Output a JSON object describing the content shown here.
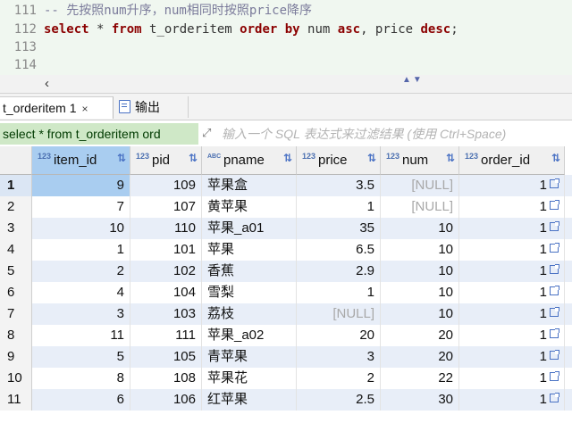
{
  "editor": {
    "lines": [
      {
        "num": "111",
        "parts": [
          {
            "t": "-- 先按照num升序，num相同时按照price降序",
            "c": "comment"
          }
        ]
      },
      {
        "num": "112",
        "parts": [
          {
            "t": "select",
            "c": "kw"
          },
          {
            "t": " * ",
            "c": "plain"
          },
          {
            "t": "from",
            "c": "kw"
          },
          {
            "t": " t_orderitem ",
            "c": "plain"
          },
          {
            "t": "order by",
            "c": "kw"
          },
          {
            "t": " num ",
            "c": "plain"
          },
          {
            "t": "asc",
            "c": "kw"
          },
          {
            "t": ", price ",
            "c": "plain"
          },
          {
            "t": "desc",
            "c": "kw"
          },
          {
            "t": ";",
            "c": "plain"
          }
        ]
      },
      {
        "num": "113",
        "parts": []
      },
      {
        "num": "114",
        "parts": []
      }
    ]
  },
  "tabs": {
    "result_tab": "t_orderitem 1",
    "close_glyph": "×",
    "output_tab": "输出"
  },
  "filter": {
    "query": "select * from t_orderitem ord",
    "placeholder": "输入一个 SQL 表达式来过滤结果 (使用 Ctrl+Space)"
  },
  "grid": {
    "columns": [
      {
        "name": "item_id",
        "type": "123"
      },
      {
        "name": "pid",
        "type": "123"
      },
      {
        "name": "pname",
        "type": "ABC"
      },
      {
        "name": "price",
        "type": "123"
      },
      {
        "name": "num",
        "type": "123"
      },
      {
        "name": "order_id",
        "type": "123"
      }
    ],
    "rows": [
      {
        "rn": "1",
        "cells": [
          "9",
          "109",
          "苹果盒",
          "3.5",
          "[NULL]",
          "1"
        ]
      },
      {
        "rn": "2",
        "cells": [
          "7",
          "107",
          "黄苹果",
          "1",
          "[NULL]",
          "1"
        ]
      },
      {
        "rn": "3",
        "cells": [
          "10",
          "110",
          "苹果_a01",
          "35",
          "10",
          "1"
        ]
      },
      {
        "rn": "4",
        "cells": [
          "1",
          "101",
          "苹果",
          "6.5",
          "10",
          "1"
        ]
      },
      {
        "rn": "5",
        "cells": [
          "2",
          "102",
          "香蕉",
          "2.9",
          "10",
          "1"
        ]
      },
      {
        "rn": "6",
        "cells": [
          "4",
          "104",
          "雪梨",
          "1",
          "10",
          "1"
        ]
      },
      {
        "rn": "7",
        "cells": [
          "3",
          "103",
          "荔枝",
          "[NULL]",
          "10",
          "1"
        ]
      },
      {
        "rn": "8",
        "cells": [
          "11",
          "111",
          "苹果_a02",
          "20",
          "20",
          "1"
        ]
      },
      {
        "rn": "9",
        "cells": [
          "5",
          "105",
          "青苹果",
          "3",
          "20",
          "1"
        ]
      },
      {
        "rn": "10",
        "cells": [
          "8",
          "108",
          "苹果花",
          "2",
          "22",
          "1"
        ]
      },
      {
        "rn": "11",
        "cells": [
          "6",
          "106",
          "红苹果",
          "2.5",
          "30",
          "1"
        ]
      }
    ]
  },
  "colors": {
    "editor_bg": "#f0f7f0",
    "keyword": "#8b0000",
    "comment": "#7a7a9a",
    "selection": "#a9cdf0",
    "row_alt": "#e8eef8",
    "filter_query_bg": "#cfe8c7"
  }
}
